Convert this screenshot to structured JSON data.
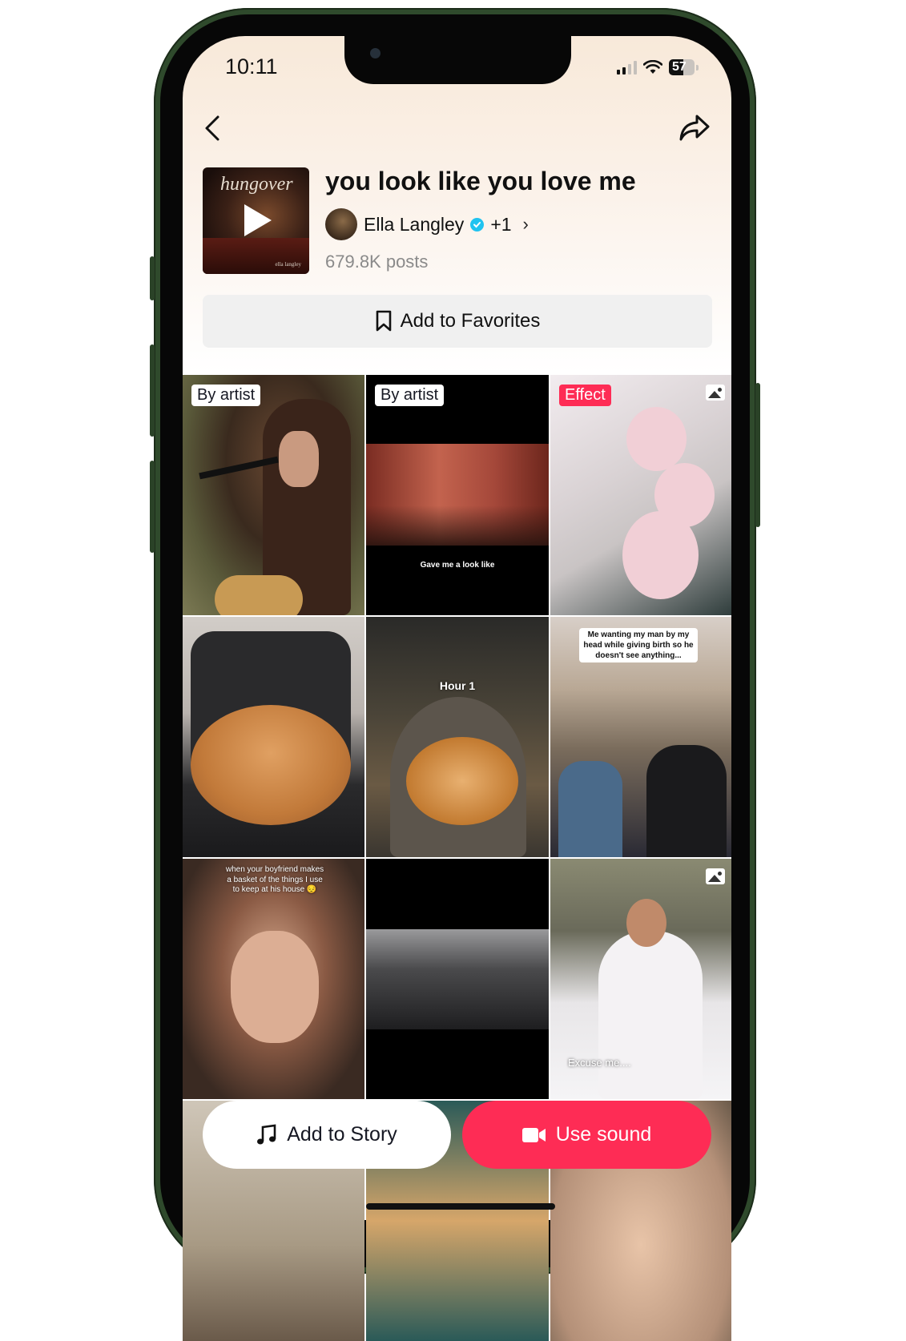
{
  "status_bar": {
    "time": "10:11",
    "battery_level": "57"
  },
  "header": {
    "back_icon": "chevron-left-icon",
    "share_icon": "share-arrow-icon"
  },
  "sound": {
    "cover_title": "hungover",
    "cover_credit": "ella langley",
    "title": "you look like you love me",
    "artist": "Ella Langley",
    "artist_verified": true,
    "extra_artists": "+1",
    "posts": "679.8K posts"
  },
  "favorites_button": {
    "label": "Add to Favorites",
    "icon": "bookmark-icon"
  },
  "grid": {
    "tiles": [
      {
        "badge": "By artist",
        "badge_type": "artist",
        "caption": ""
      },
      {
        "badge": "By artist",
        "badge_type": "artist",
        "caption": "Gave me a look like"
      },
      {
        "badge": "Effect",
        "badge_type": "effect",
        "caption": "",
        "photo_post": true
      },
      {
        "badge": "",
        "caption": ""
      },
      {
        "badge": "",
        "caption": "Hour 1"
      },
      {
        "badge": "",
        "caption": "Me wanting my man by my head while giving birth so he doesn't see anything..."
      },
      {
        "badge": "",
        "caption": "when your boyfriend makes a basket of the things I use to keep at his house 😔"
      },
      {
        "badge": "",
        "caption": ""
      },
      {
        "badge": "",
        "caption": "Excuse me....",
        "photo_post": true
      },
      {
        "badge": "",
        "caption": ""
      },
      {
        "badge": "",
        "caption": ""
      },
      {
        "badge": "",
        "caption": ""
      }
    ]
  },
  "actions": {
    "add_to_story": "Add to Story",
    "use_sound": "Use sound"
  },
  "colors": {
    "accent": "#fe2c55",
    "verified": "#20c3f0",
    "phone_frame": "#2f4a2c"
  }
}
